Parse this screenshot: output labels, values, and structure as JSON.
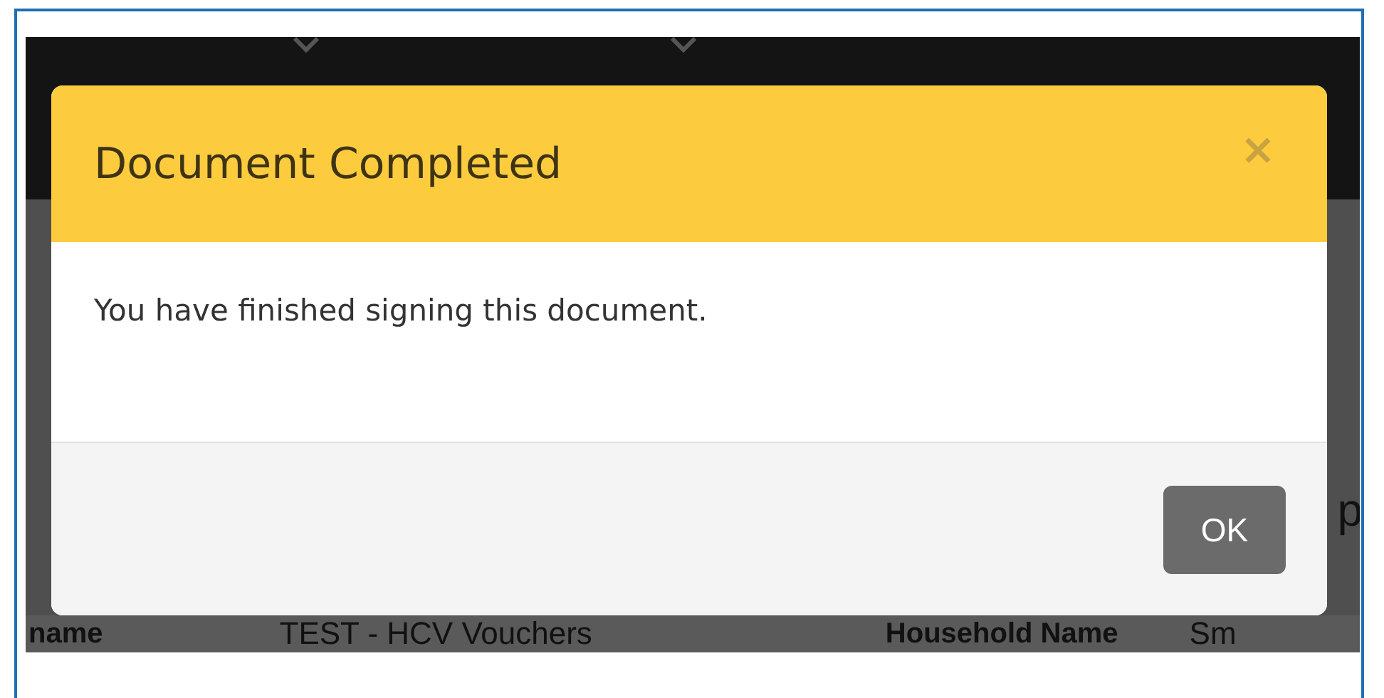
{
  "background_page": {
    "heading_fragment": "p",
    "fields": [
      {
        "label": "name",
        "value": "TEST - HCV Vouchers"
      },
      {
        "label": "Household Name",
        "value": "Sm"
      }
    ]
  },
  "dialog": {
    "title": "Document Completed",
    "close": "×",
    "message": "You have finished signing this document.",
    "buttons": [
      {
        "label": "OK"
      }
    ]
  }
}
